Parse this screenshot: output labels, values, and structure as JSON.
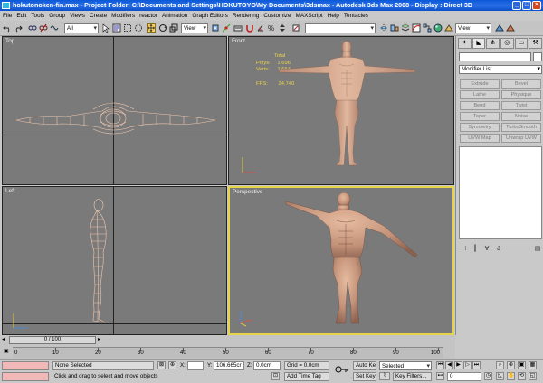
{
  "window": {
    "title": "hokutonoken-fin.max   - Project Folder: C:\\Documents and Settings\\HOKUTOYO\\My Documents\\3dsmax   - Autodesk 3ds Max 2008   - Display : Direct 3D"
  },
  "menu": [
    "File",
    "Edit",
    "Tools",
    "Group",
    "Views",
    "Create",
    "Modifiers",
    "reactor",
    "Animation",
    "Graph Editors",
    "Rendering",
    "Customize",
    "MAXScript",
    "Help",
    "Tentacles"
  ],
  "toolbar": {
    "selection_filter": "All",
    "reference_coord": "View",
    "named_selection": "",
    "render_view": "View"
  },
  "viewports": {
    "top": {
      "label": "Top"
    },
    "front": {
      "label": "Front"
    },
    "left": {
      "label": "Left"
    },
    "perspective": {
      "label": "Perspective"
    }
  },
  "stats": {
    "header": "Total",
    "polys_label": "Polys:",
    "polys_value": "1,696",
    "verts_label": "Verts:",
    "verts_value": "1,664",
    "fps_label": "FPS:",
    "fps_value": "24.740"
  },
  "command_panel": {
    "modifier_list": "Modifier List",
    "buttons": [
      "Extrude",
      "Bevel",
      "Lathe",
      "Physique",
      "Bend",
      "Twist",
      "Taper",
      "Noise",
      "Symmetry",
      "TurboSmooth",
      "UVW Map",
      "Unwrap UVW"
    ]
  },
  "timeline": {
    "slider": "0 / 100",
    "ticks": [
      "0",
      "10",
      "20",
      "30",
      "40",
      "50",
      "60",
      "70",
      "80",
      "90",
      "100"
    ]
  },
  "status": {
    "selection": "None Selected",
    "prompt": "Click and drag to select and move objects",
    "x_label": "X:",
    "y_label": "Y:",
    "y_value": "106.665cr",
    "z_label": "Z:",
    "z_value": "0.0cm",
    "grid": "Grid = 0.0cm",
    "add_time_tag": "Add Time Tag",
    "auto_key": "Auto Key",
    "set_key": "Set Key",
    "key_mode": "Selected",
    "key_filters": "Key Filters...",
    "frame": "0"
  }
}
